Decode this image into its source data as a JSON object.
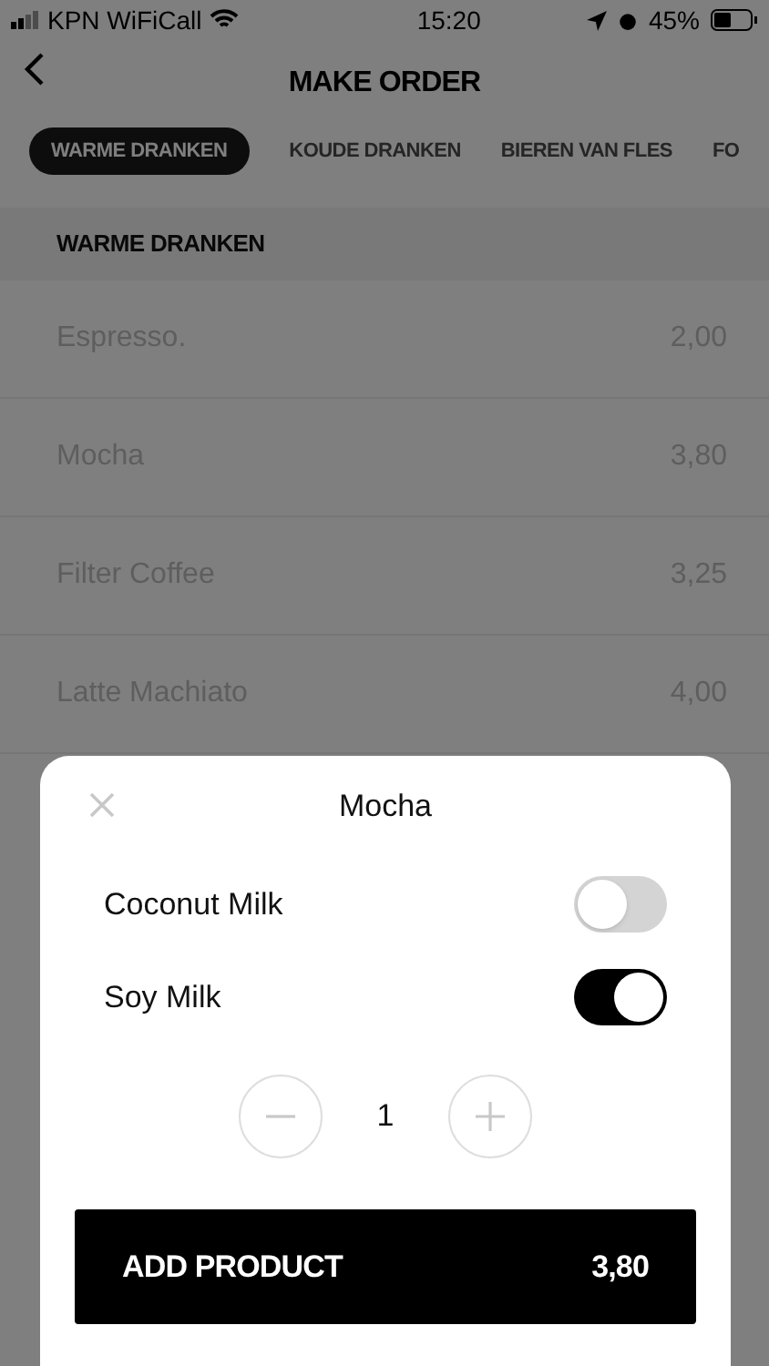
{
  "status_bar": {
    "carrier": "KPN WiFiCall",
    "time": "15:20",
    "battery": "45%"
  },
  "header": {
    "title": "MAKE ORDER"
  },
  "tabs": [
    {
      "label": "WARME DRANKEN",
      "selected": true
    },
    {
      "label": "KOUDE DRANKEN",
      "selected": false
    },
    {
      "label": "BIEREN VAN FLES",
      "selected": false
    },
    {
      "label": "FO",
      "selected": false
    }
  ],
  "section": {
    "title": "WARME DRANKEN"
  },
  "products": [
    {
      "name": "Espresso.",
      "price": "2,00"
    },
    {
      "name": "Mocha",
      "price": "3,80"
    },
    {
      "name": "Filter Coffee",
      "price": "3,25"
    },
    {
      "name": "Latte Machiato",
      "price": "4,00"
    }
  ],
  "modal": {
    "title": "Mocha",
    "options": [
      {
        "label": "Coconut Milk",
        "on": false
      },
      {
        "label": "Soy Milk",
        "on": true
      }
    ],
    "quantity": "1",
    "add_button": {
      "label": "ADD PRODUCT",
      "price": "3,80"
    }
  }
}
